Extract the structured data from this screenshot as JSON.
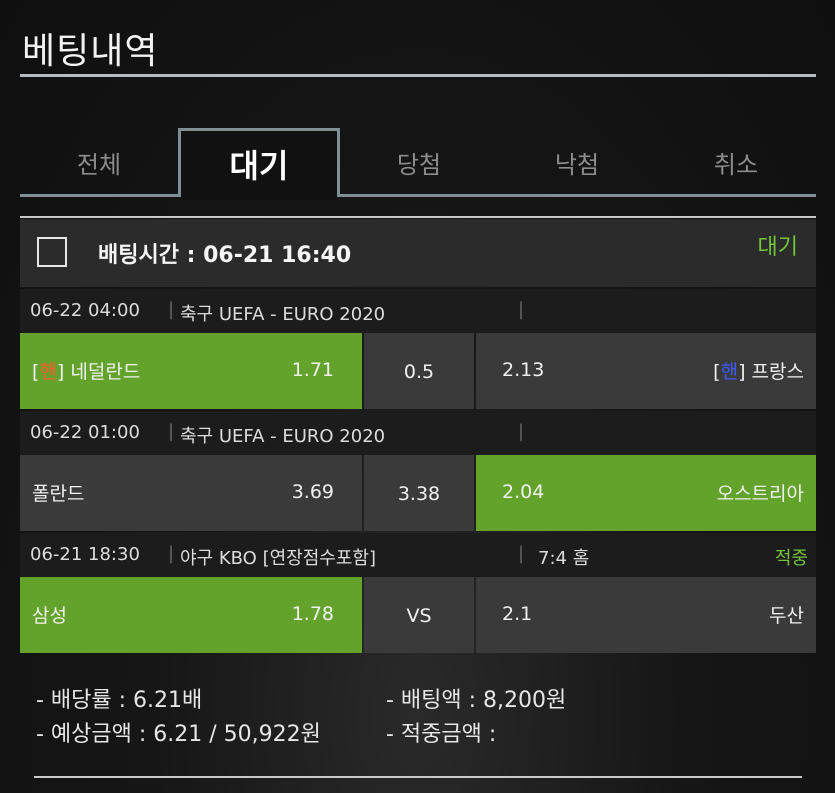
{
  "page": {
    "title": "베팅내역"
  },
  "tabs": [
    {
      "label": "전체"
    },
    {
      "label": "대기"
    },
    {
      "label": "당첨"
    },
    {
      "label": "낙첨"
    },
    {
      "label": "취소"
    }
  ],
  "active_tab": "대기",
  "bet": {
    "time_label": "배팅시간 : 06-21 16:40",
    "status": "대기",
    "matches": [
      {
        "datetime": "06-22 04:00",
        "league": "축구 UEFA - EURO 2020",
        "score": "",
        "result": "",
        "home_prefix_open": "[",
        "home_prefix_mark": "핸",
        "home_prefix_close": "]",
        "home_team": "네덜란드",
        "home_odd": "1.71",
        "middle": "0.5",
        "away_odd": "2.13",
        "away_prefix_open": "[",
        "away_prefix_mark": "핸",
        "away_prefix_close": "]",
        "away_team": "프랑스",
        "selected": "home"
      },
      {
        "datetime": "06-22 01:00",
        "league": "축구 UEFA - EURO 2020",
        "score": "",
        "result": "",
        "home_team": "폴란드",
        "home_odd": "3.69",
        "middle": "3.38",
        "away_odd": "2.04",
        "away_team": "오스트리아",
        "selected": "away"
      },
      {
        "datetime": "06-21 18:30",
        "league": "야구 KBO [연장점수포함]",
        "score": "7:4 홈",
        "result": "적중",
        "home_team": "삼성",
        "home_odd": "1.78",
        "middle": "VS",
        "away_odd": "2.1",
        "away_team": "두산",
        "selected": "home"
      }
    ]
  },
  "summary": {
    "odds": "- 배당률 : 6.21배",
    "bet_amount": "- 배팅액 : 8,200원",
    "expected": "- 예상금액 : 6.21 / 50,922원",
    "win_amount": "- 적중금액 :"
  },
  "colors": {
    "accent_green": "#63a32b",
    "status_green": "#74c43a",
    "home_tag": "#ff5a2a",
    "away_tag": "#3d5bff"
  }
}
